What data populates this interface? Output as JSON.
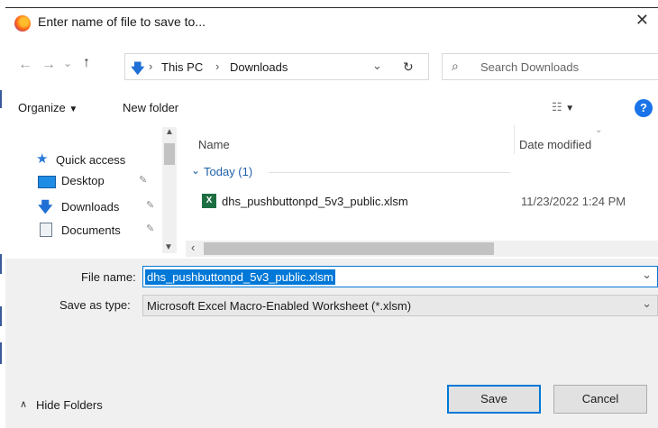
{
  "title": "Enter name of file to save to...",
  "nav": {
    "path": [
      "This PC",
      "Downloads"
    ],
    "search_placeholder": "Search Downloads"
  },
  "toolbar": {
    "organize": "Organize",
    "new_folder": "New folder",
    "help": "?"
  },
  "sidebar": {
    "items": [
      {
        "label": "Quick access"
      },
      {
        "label": "Desktop"
      },
      {
        "label": "Downloads"
      },
      {
        "label": "Documents"
      }
    ]
  },
  "file_list": {
    "columns": [
      "Name",
      "Date modified"
    ],
    "group": "Today (1)",
    "files": [
      {
        "name": "dhs_pushbuttonpd_5v3_public.xlsm",
        "date": "11/23/2022 1:24 PM"
      }
    ]
  },
  "form": {
    "filename_label": "File name:",
    "filename_value": "dhs_pushbuttonpd_5v3_public.xlsm",
    "savetype_label": "Save as type:",
    "savetype_value": "Microsoft Excel Macro-Enabled Worksheet (*.xlsm)"
  },
  "footer": {
    "hide_folders": "Hide Folders",
    "save": "Save",
    "cancel": "Cancel"
  },
  "colors": {
    "accent": "#0078d7",
    "excel_green": "#1d6f42",
    "help_blue": "#1a73e8"
  }
}
